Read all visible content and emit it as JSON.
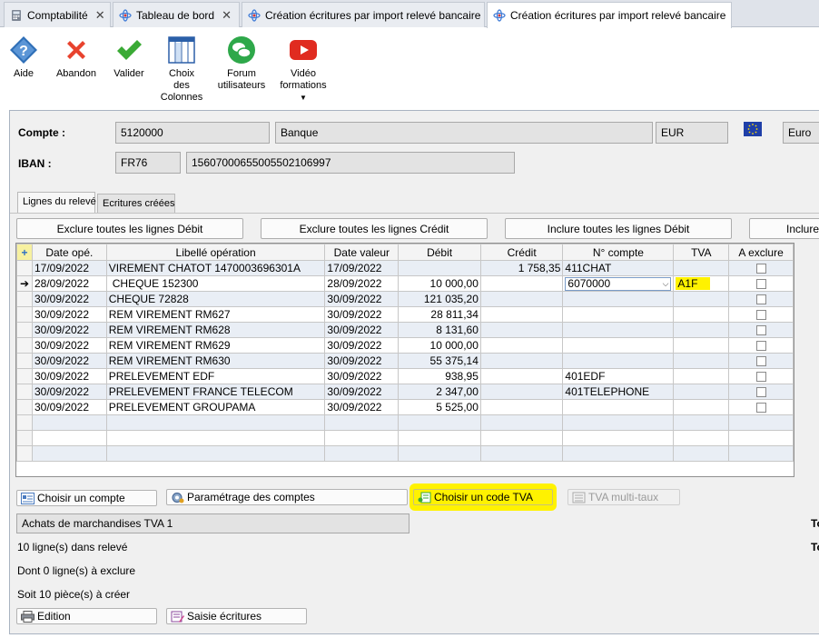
{
  "tabs": [
    {
      "label": "Comptabilité",
      "icon": "calculator-icon",
      "closable": true
    },
    {
      "label": "Tableau de bord",
      "icon": "dashboard-icon",
      "closable": true
    },
    {
      "label": "Création écritures par import relevé bancaire",
      "icon": "atom-icon",
      "closable": true
    },
    {
      "label": "Création écritures par import relevé bancaire",
      "icon": "atom-icon",
      "closable": true,
      "active": true
    }
  ],
  "toolbar": {
    "aide": "Aide",
    "abandon": "Abandon",
    "valider": "Valider",
    "choix_colonnes": [
      "Choix",
      "des",
      "Colonnes"
    ],
    "forum": [
      "Forum",
      "utilisateurs"
    ],
    "video": [
      "Vidéo",
      "formations"
    ]
  },
  "account": {
    "compte_label": "Compte :",
    "compte_value": "5120000",
    "compte_name": "Banque",
    "currency": "EUR",
    "currency_name": "Euro",
    "iban_label": "IBAN :",
    "iban_prefix": "FR76",
    "iban_rest": "15607000655005502106997"
  },
  "subtabs": [
    "Lignes du relevé",
    "Ecritures créées"
  ],
  "bulk_buttons": [
    "Exclure toutes les lignes Débit",
    "Exclure toutes les lignes Crédit",
    "Inclure toutes les lignes Débit",
    "Inclure"
  ],
  "grid": {
    "corner": "+",
    "columns": [
      "Date opé.",
      "Libellé opération",
      "Date valeur",
      "Débit",
      "Crédit",
      "N° compte",
      "TVA",
      "A exclure"
    ],
    "rows": [
      {
        "date": "17/09/2022",
        "libelle": "VIREMENT CHATOT 1470003696301A",
        "date_valeur": "17/09/2022",
        "debit": "",
        "credit": "1 758,35",
        "compte": "411CHAT",
        "tva": "",
        "current": false
      },
      {
        "date": "28/09/2022",
        "libelle": "CHEQUE 152300",
        "date_valeur": "28/09/2022",
        "debit": "10 000,00",
        "credit": "",
        "compte": "6070000",
        "tva": "A1F",
        "current": true
      },
      {
        "date": "30/09/2022",
        "libelle": "CHEQUE 72828",
        "date_valeur": "30/09/2022",
        "debit": "121 035,20",
        "credit": "",
        "compte": "",
        "tva": "",
        "current": false
      },
      {
        "date": "30/09/2022",
        "libelle": "REM VIREMENT RM627",
        "date_valeur": "30/09/2022",
        "debit": "28 811,34",
        "credit": "",
        "compte": "",
        "tva": "",
        "current": false
      },
      {
        "date": "30/09/2022",
        "libelle": "REM VIREMENT RM628",
        "date_valeur": "30/09/2022",
        "debit": "8 131,60",
        "credit": "",
        "compte": "",
        "tva": "",
        "current": false
      },
      {
        "date": "30/09/2022",
        "libelle": "REM VIREMENT RM629",
        "date_valeur": "30/09/2022",
        "debit": "10 000,00",
        "credit": "",
        "compte": "",
        "tva": "",
        "current": false
      },
      {
        "date": "30/09/2022",
        "libelle": "REM VIREMENT RM630",
        "date_valeur": "30/09/2022",
        "debit": "55 375,14",
        "credit": "",
        "compte": "",
        "tva": "",
        "current": false
      },
      {
        "date": "30/09/2022",
        "libelle": "PRELEVEMENT EDF",
        "date_valeur": "30/09/2022",
        "debit": "938,95",
        "credit": "",
        "compte": "401EDF",
        "tva": "",
        "current": false
      },
      {
        "date": "30/09/2022",
        "libelle": "PRELEVEMENT FRANCE TELECOM",
        "date_valeur": "30/09/2022",
        "debit": "2 347,00",
        "credit": "",
        "compte": "401TELEPHONE",
        "tva": "",
        "current": false
      },
      {
        "date": "30/09/2022",
        "libelle": "PRELEVEMENT GROUPAMA",
        "date_valeur": "30/09/2022",
        "debit": "5 525,00",
        "credit": "",
        "compte": "",
        "tva": "",
        "current": false
      }
    ]
  },
  "actions": {
    "choisir_compte": "Choisir un compte",
    "parametrage": "Paramétrage des comptes",
    "choisir_tva": "Choisir un code TVA",
    "tva_multi": "TVA multi-taux",
    "edition": "Edition",
    "saisie": "Saisie écritures"
  },
  "summary": {
    "tva_description": "Achats de marchandises TVA 1",
    "lines_in_statement": "10 ligne(s) dans relevé",
    "lines_excluded": "Dont 0 ligne(s) à exclure",
    "pieces_to_create": "Soit 10 pièce(s) à créer",
    "right_label_1": "To",
    "right_label_2": "To"
  },
  "colors": {
    "highlight": "#fff200",
    "row_alt": "#e9eef5",
    "abandon_red": "#e8432e",
    "valider_green": "#3aaa35",
    "aide_blue": "#2f6fb7"
  }
}
